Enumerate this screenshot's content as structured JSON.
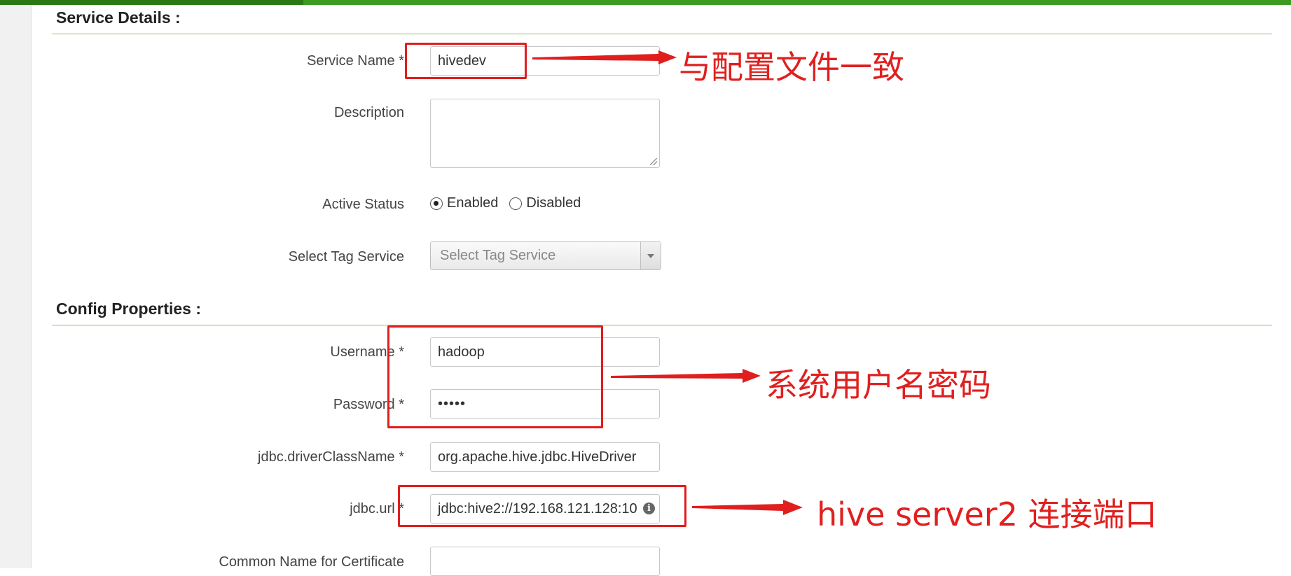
{
  "service_details": {
    "title": "Service Details :",
    "service_name": {
      "label": "Service Name *",
      "value": "hivedev"
    },
    "description": {
      "label": "Description",
      "value": ""
    },
    "active_status": {
      "label": "Active Status",
      "options": [
        "Enabled",
        "Disabled"
      ],
      "selected": "Enabled"
    },
    "tag_service": {
      "label": "Select Tag Service",
      "placeholder": "Select Tag Service"
    }
  },
  "config_properties": {
    "title": "Config Properties :",
    "username": {
      "label": "Username *",
      "value": "hadoop"
    },
    "password": {
      "label": "Password *",
      "value": "•••••"
    },
    "driver": {
      "label": "jdbc.driverClassName *",
      "value": "org.apache.hive.jdbc.HiveDriver"
    },
    "jdbc_url": {
      "label": "jdbc.url *",
      "value": "jdbc:hive2://192.168.121.128:10"
    },
    "common_name": {
      "label": "Common Name for Certificate",
      "value": ""
    }
  },
  "annotations": {
    "config_file": "与配置文件一致",
    "credentials": "系统用户名密码",
    "hive_port": "hive server2 连接端口"
  },
  "colors": {
    "accent_green": "#3d9a22",
    "annotation_red": "#e01e1e"
  }
}
